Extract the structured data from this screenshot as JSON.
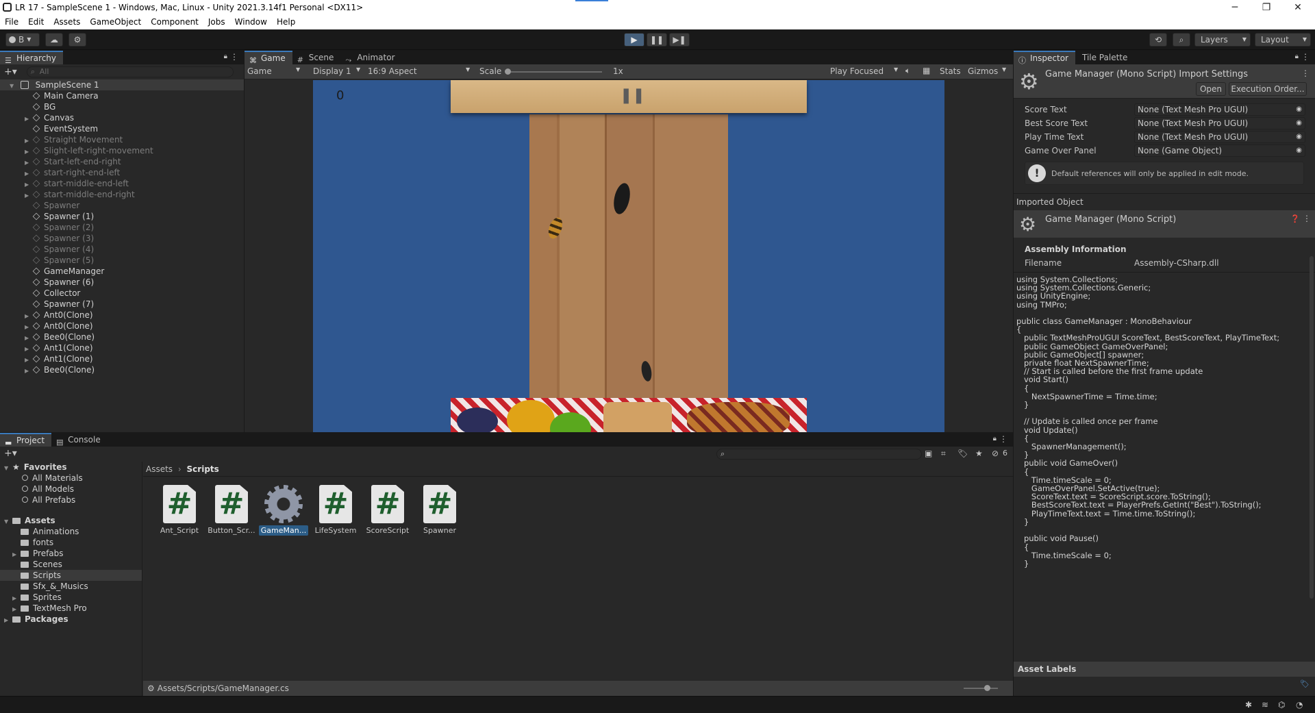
{
  "window": {
    "title": "LR 17 - SampleScene 1 - Windows, Mac, Linux - Unity 2021.3.14f1 Personal <DX11>",
    "controls": [
      "─",
      "❐",
      "✕"
    ]
  },
  "menu": [
    "File",
    "Edit",
    "Assets",
    "GameObject",
    "Component",
    "Jobs",
    "Window",
    "Help"
  ],
  "toolbar": {
    "account": "B",
    "layers": "Layers",
    "layout": "Layout"
  },
  "hierarchy": {
    "tab": "Hierarchy",
    "search_placeholder": "All",
    "scene": "SampleScene 1",
    "items": [
      {
        "label": "Main Camera",
        "arrow": false,
        "dim": false
      },
      {
        "label": "BG",
        "arrow": false,
        "dim": false
      },
      {
        "label": "Canvas",
        "arrow": true,
        "dim": false
      },
      {
        "label": "EventSystem",
        "arrow": false,
        "dim": false
      },
      {
        "label": "Straight Movement",
        "arrow": true,
        "dim": true
      },
      {
        "label": "Slight-left-right-movement",
        "arrow": true,
        "dim": true
      },
      {
        "label": "Start-left-end-right",
        "arrow": true,
        "dim": true
      },
      {
        "label": "start-right-end-left",
        "arrow": true,
        "dim": true
      },
      {
        "label": "start-middle-end-left",
        "arrow": true,
        "dim": true
      },
      {
        "label": "start-middle-end-right",
        "arrow": true,
        "dim": true
      },
      {
        "label": "Spawner",
        "arrow": false,
        "dim": true
      },
      {
        "label": "Spawner (1)",
        "arrow": false,
        "dim": false
      },
      {
        "label": "Spawner (2)",
        "arrow": false,
        "dim": true
      },
      {
        "label": "Spawner (3)",
        "arrow": false,
        "dim": true
      },
      {
        "label": "Spawner (4)",
        "arrow": false,
        "dim": true
      },
      {
        "label": "Spawner (5)",
        "arrow": false,
        "dim": true
      },
      {
        "label": "GameManager",
        "arrow": false,
        "dim": false
      },
      {
        "label": "Spawner (6)",
        "arrow": false,
        "dim": false
      },
      {
        "label": "Collector",
        "arrow": false,
        "dim": false
      },
      {
        "label": "Spawner (7)",
        "arrow": false,
        "dim": false
      },
      {
        "label": "Ant0(Clone)",
        "arrow": true,
        "dim": false
      },
      {
        "label": "Ant0(Clone)",
        "arrow": true,
        "dim": false
      },
      {
        "label": "Bee0(Clone)",
        "arrow": true,
        "dim": false
      },
      {
        "label": "Ant1(Clone)",
        "arrow": true,
        "dim": false
      },
      {
        "label": "Ant1(Clone)",
        "arrow": true,
        "dim": false
      },
      {
        "label": "Bee0(Clone)",
        "arrow": true,
        "dim": false
      }
    ]
  },
  "game_view": {
    "tabs": [
      "Game",
      "Scene",
      "Animator"
    ],
    "display_mode": "Game",
    "display": "Display 1",
    "aspect": "16:9 Aspect",
    "scale_label": "Scale",
    "scale_value": "1x",
    "play_focus": "Play Focused",
    "stats": "Stats",
    "gizmos": "Gizmos",
    "hud_left": "0",
    "pause_glyph": "❚❚"
  },
  "inspector": {
    "tabs": [
      "Inspector",
      "Tile Palette"
    ],
    "header_title": "Game Manager (Mono Script) Import Settings",
    "open_button": "Open",
    "exec_order_button": "Execution Order...",
    "fields": [
      {
        "label": "Score Text",
        "value": "None (Text Mesh Pro UGUI)"
      },
      {
        "label": "Best Score Text",
        "value": "None (Text Mesh Pro UGUI)"
      },
      {
        "label": "Play Time Text",
        "value": "None (Text Mesh Pro UGUI)"
      },
      {
        "label": "Game Over Panel",
        "value": "None (Game Object)"
      }
    ],
    "info_message": "Default references will only be applied in edit mode.",
    "imported_object_label": "Imported Object",
    "imported_title": "Game Manager (Mono Script)",
    "assembly_header": "Assembly Information",
    "filename_label": "Filename",
    "filename_value": "Assembly-CSharp.dll",
    "code": "using System.Collections;\nusing System.Collections.Generic;\nusing UnityEngine;\nusing TMPro;\n\npublic class GameManager : MonoBehaviour\n{\n   public TextMeshProUGUI ScoreText, BestScoreText, PlayTimeText;\n   public GameObject GameOverPanel;\n   public GameObject[] spawner;\n   private float NextSpawnerTime;\n   // Start is called before the first frame update\n   void Start()\n   {\n      NextSpawnerTime = Time.time;\n   }\n\n   // Update is called once per frame\n   void Update()\n   {\n      SpawnerManagement();\n   }\n   public void GameOver()\n   {\n      Time.timeScale = 0;\n      GameOverPanel.SetActive(true);\n      ScoreText.text = ScoreScript.score.ToString();\n      BestScoreText.text = PlayerPrefs.GetInt(\"Best\").ToString();\n      PlayTimeText.text = Time.time.ToString();\n   }\n\n   public void Pause()\n   {\n      Time.timeScale = 0;\n   }",
    "asset_labels": "Asset Labels"
  },
  "project": {
    "tabs": [
      "Project",
      "Console"
    ],
    "favorites_label": "Favorites",
    "favorites": [
      "All Materials",
      "All Models",
      "All Prefabs"
    ],
    "assets_label": "Assets",
    "folders": [
      {
        "label": "Animations",
        "arrow": false
      },
      {
        "label": "fonts",
        "arrow": false
      },
      {
        "label": "Prefabs",
        "arrow": true
      },
      {
        "label": "Scenes",
        "arrow": false
      },
      {
        "label": "Scripts",
        "arrow": false,
        "selected": true
      },
      {
        "label": "Sfx_&_Musics",
        "arrow": false
      },
      {
        "label": "Sprites",
        "arrow": true
      },
      {
        "label": "TextMesh Pro",
        "arrow": true
      }
    ],
    "packages_label": "Packages",
    "breadcrumb": [
      "Assets",
      "Scripts"
    ],
    "hidden_count": "6",
    "assets": [
      {
        "label": "Ant_Script",
        "kind": "script"
      },
      {
        "label": "Button_Scr...",
        "kind": "script"
      },
      {
        "label": "GameMan...",
        "kind": "gear",
        "selected": true
      },
      {
        "label": "LifeSystem",
        "kind": "script"
      },
      {
        "label": "ScoreScript",
        "kind": "script"
      },
      {
        "label": "Spawner",
        "kind": "script"
      }
    ],
    "status_path": "Assets/Scripts/GameManager.cs"
  },
  "colors": {
    "accent": "#3a79bb",
    "game_bg": "#2f5790",
    "wood": "#a8784f",
    "selected_asset": "#2c5d87"
  }
}
